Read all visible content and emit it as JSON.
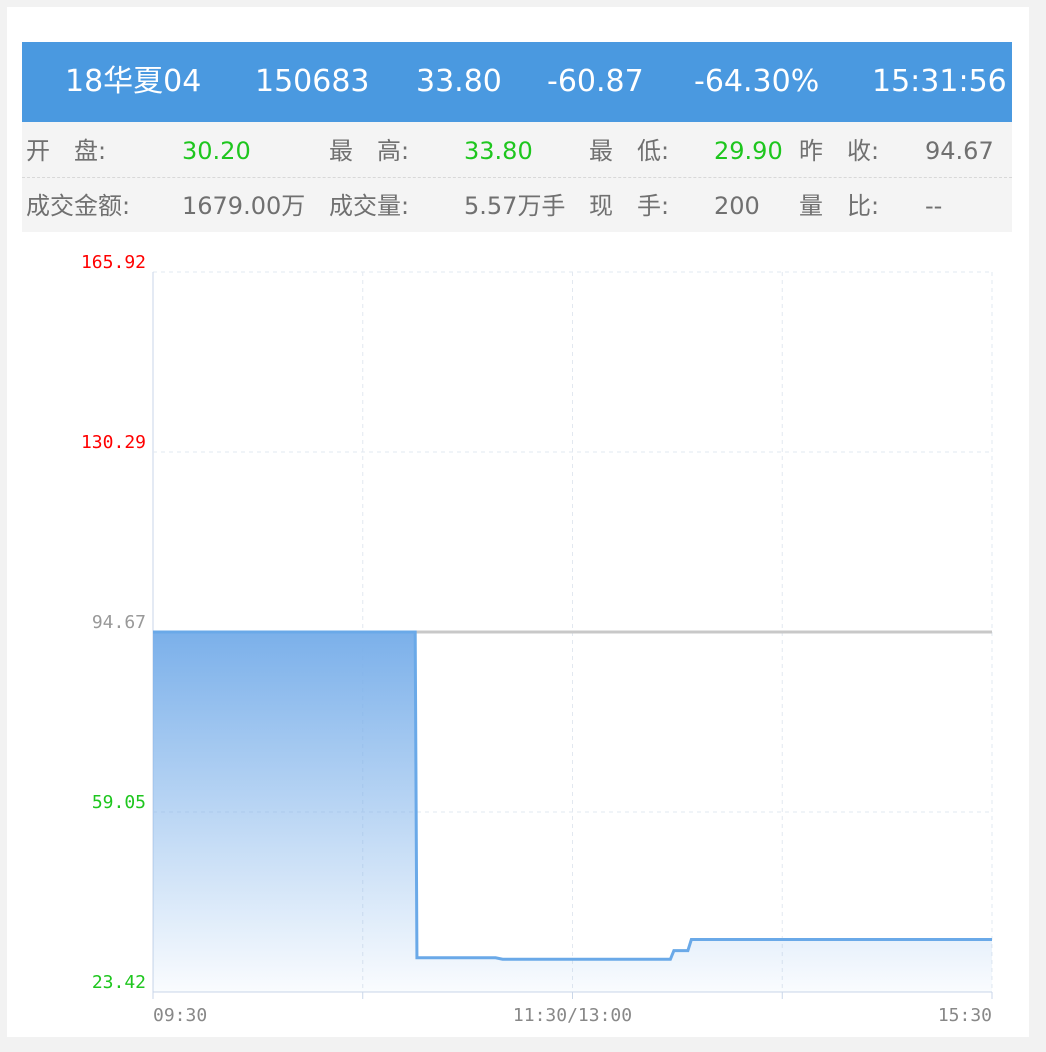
{
  "quote": {
    "name": "18华夏04",
    "code": "150683",
    "price": "33.80",
    "change": "-60.87",
    "change_pct": "-64.30%",
    "time": "15:31:56"
  },
  "stats": {
    "open_label": "开　盘:",
    "open_value": "30.20",
    "high_label": "最　高:",
    "high_value": "33.80",
    "low_label": "最　低:",
    "low_value": "29.90",
    "prev_close_label": "昨　收:",
    "prev_close_value": "94.67",
    "amount_label": "成交金额:",
    "amount_value": "1679.00万",
    "volume_label": "成交量:",
    "volume_value": "5.57万手",
    "current_hand_label": "现　手:",
    "current_hand_value": "200",
    "volume_ratio_label": "量　比:",
    "volume_ratio_value": "--"
  },
  "colors": {
    "header_bg": "#4a99e0",
    "up": "#ff0000",
    "down": "#1ec61e",
    "flat": "#999999",
    "line": "#6aa9e8",
    "prev_close_line": "#c8c8c8"
  },
  "chart_data": {
    "type": "area",
    "ylim": [
      23.42,
      165.92
    ],
    "y_ticks": [
      "165.92",
      "130.29",
      "94.67",
      "59.05",
      "23.42"
    ],
    "y_tick_values": [
      165.92,
      130.29,
      94.67,
      59.05,
      23.42
    ],
    "y_tick_colors": [
      "up",
      "up",
      "flat",
      "down",
      "down"
    ],
    "x_ticks": [
      "09:30",
      "11:30/13:00",
      "15:30"
    ],
    "x_range_minutes": [
      0,
      240
    ],
    "reference_line": 94.67,
    "grid": true,
    "series": [
      {
        "x": [
          0,
          75,
          75.5,
          98,
          100,
          148,
          149,
          153,
          154,
          240
        ],
        "y": [
          94.67,
          94.67,
          30.2,
          30.2,
          29.9,
          29.9,
          31.6,
          31.6,
          33.8,
          33.8
        ]
      }
    ]
  }
}
